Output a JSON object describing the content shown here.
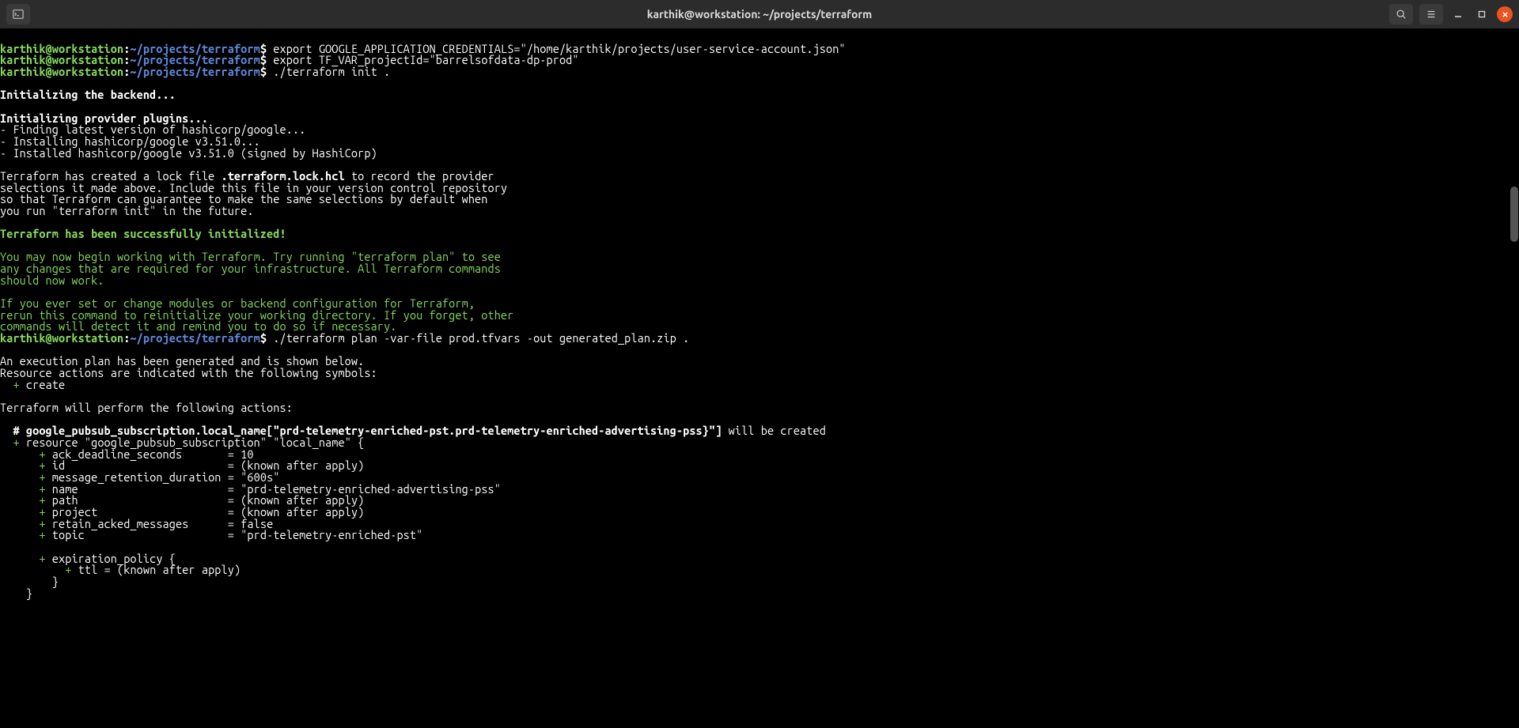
{
  "window": {
    "title": "karthik@workstation: ~/projects/terraform"
  },
  "prompt": {
    "host": "karthik@workstation",
    "colon": ":",
    "path": "~/projects/terraform",
    "sigil": "$"
  },
  "commands": {
    "c1": " export GOOGLE_APPLICATION_CREDENTIALS=\"/home/karthik/projects/user-service-account.json\"",
    "c2": " export TF_VAR_projectId=\"barrelsofdata-dp-prod\"",
    "c3": " ./terraform init .",
    "c4": " ./terraform plan -var-file prod.tfvars -out generated_plan.zip ."
  },
  "out": {
    "blank": "",
    "init_backend": "Initializing the backend...",
    "init_plugins": "Initializing provider plugins...",
    "finding": "- Finding latest version of hashicorp/google...",
    "installing": "- Installing hashicorp/google v3.51.0...",
    "installed": "- Installed hashicorp/google v3.51.0 (signed by HashiCorp)",
    "lock1a": "Terraform has created a lock file ",
    "lock1b": ".terraform.lock.hcl",
    "lock1c": " to record the provider",
    "lock2": "selections it made above. Include this file in your version control repository",
    "lock3": "so that Terraform can guarantee to make the same selections by default when",
    "lock4": "you run \"terraform init\" in the future.",
    "success": "Terraform has been successfully initialized!",
    "g1": "You may now begin working with Terraform. Try running \"terraform plan\" to see",
    "g2": "any changes that are required for your infrastructure. All Terraform commands",
    "g3": "should now work.",
    "g4": "If you ever set or change modules or backend configuration for Terraform,",
    "g5": "rerun this command to reinitialize your working directory. If you forget, other",
    "g6": "commands will detect it and remind you to do so if necessary.",
    "plan1": "An execution plan has been generated and is shown below.",
    "plan2": "Resource actions are indicated with the following symbols:",
    "plan3a": "  ",
    "plan3b": "+",
    "plan3c": " create",
    "plan4": "Terraform will perform the following actions:",
    "res_hash": "  # google_pubsub_subscription.local_name[\"prd-telemetry-enriched-pst.prd-telemetry-enriched-advertising-pss}\"]",
    "res_tail": " will be created",
    "r_open_a": "  ",
    "r_open_b": "+",
    "r_open_c": " ",
    "r_open_d": "resource \"google_pubsub_subscription\" \"local_name\" {",
    "a1a": "      ",
    "a1p": "+",
    "a1s": " ",
    "a1k": "ack_deadline_seconds      ",
    "a1e": " = ",
    "a1v": "10",
    "a2a": "      ",
    "a2p": "+",
    "a2s": " ",
    "a2k": "id                        ",
    "a2e": " = (known after apply)",
    "a3a": "      ",
    "a3p": "+",
    "a3s": " ",
    "a3k": "message_retention_duration",
    "a3e": " = ",
    "a3v": "\"600s\"",
    "a4a": "      ",
    "a4p": "+",
    "a4s": " ",
    "a4k": "name                      ",
    "a4e": " = ",
    "a4v": "\"prd-telemetry-enriched-advertising-pss\"",
    "a5a": "      ",
    "a5p": "+",
    "a5s": " ",
    "a5k": "path                      ",
    "a5e": " = (known after apply)",
    "a6a": "      ",
    "a6p": "+",
    "a6s": " ",
    "a6k": "project                   ",
    "a6e": " = (known after apply)",
    "a7a": "      ",
    "a7p": "+",
    "a7s": " ",
    "a7k": "retain_acked_messages     ",
    "a7e": " = ",
    "a7v": "false",
    "a8a": "      ",
    "a8p": "+",
    "a8s": " ",
    "a8k": "topic                     ",
    "a8e": " = ",
    "a8v": "\"prd-telemetry-enriched-pst\"",
    "exp1a": "      ",
    "exp1p": "+",
    "exp1s": " ",
    "exp1k": "expiration_policy {",
    "exp2a": "          ",
    "exp2p": "+",
    "exp2s": " ",
    "exp2k": "ttl",
    "exp2e": " = (known after apply)",
    "exp3": "        }",
    "close": "    }"
  }
}
